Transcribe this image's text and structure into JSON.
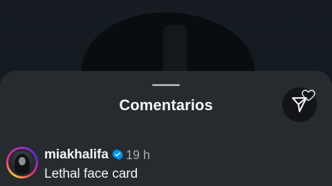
{
  "sheet": {
    "title": "Comentarios"
  },
  "comment": {
    "username": "miakhalifa",
    "verified": true,
    "timestamp": "19 h",
    "text": "Lethal face card"
  },
  "icons": {
    "share": "send-icon",
    "verified": "verified-badge-icon",
    "like": "heart-icon"
  },
  "colors": {
    "sheet_background": "#262b30",
    "verified_blue": "#0095f6",
    "muted_text": "#a8abae"
  }
}
